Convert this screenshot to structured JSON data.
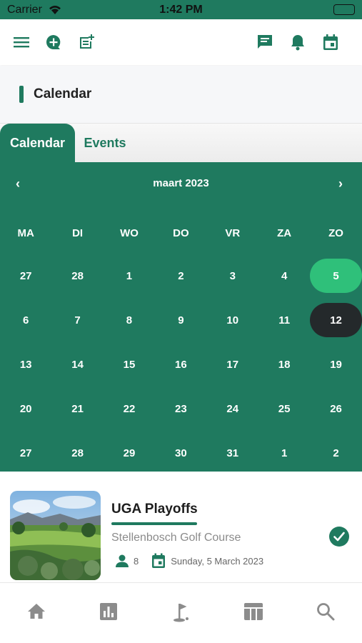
{
  "status_bar": {
    "carrier": "Carrier",
    "time": "1:42 PM"
  },
  "toolbar": {
    "left_icons": [
      "menu-icon",
      "add-chat-icon",
      "add-note-icon"
    ],
    "right_icons": [
      "message-icon",
      "bell-icon",
      "calendar-icon"
    ]
  },
  "page": {
    "title": "Calendar"
  },
  "tabs": [
    {
      "label": "Calendar",
      "active": true
    },
    {
      "label": "Events",
      "active": false
    }
  ],
  "calendar": {
    "prev": "‹",
    "next": "›",
    "month": "maart 2023",
    "weekdays": [
      "MA",
      "DI",
      "WO",
      "DO",
      "VR",
      "ZA",
      "ZO"
    ],
    "weeks": [
      [
        "27",
        "28",
        "1",
        "2",
        "3",
        "4",
        "5"
      ],
      [
        "6",
        "7",
        "8",
        "9",
        "10",
        "11",
        "12"
      ],
      [
        "13",
        "14",
        "15",
        "16",
        "17",
        "18",
        "19"
      ],
      [
        "20",
        "21",
        "22",
        "23",
        "24",
        "25",
        "26"
      ],
      [
        "27",
        "28",
        "29",
        "30",
        "31",
        "1",
        "2"
      ]
    ],
    "today": "5",
    "selected": "12"
  },
  "event": {
    "title": "UGA Playoffs",
    "venue": "Stellenbosch Golf Course",
    "participants": "8",
    "date": "Sunday, 5 March 2023",
    "status": "confirmed"
  },
  "bottom_nav": [
    "home-icon",
    "stats-icon",
    "golf-icon",
    "table-icon",
    "search-icon"
  ],
  "colors": {
    "primary": "#1f7a5f",
    "today": "#2fc07a",
    "selected": "#24292b"
  }
}
